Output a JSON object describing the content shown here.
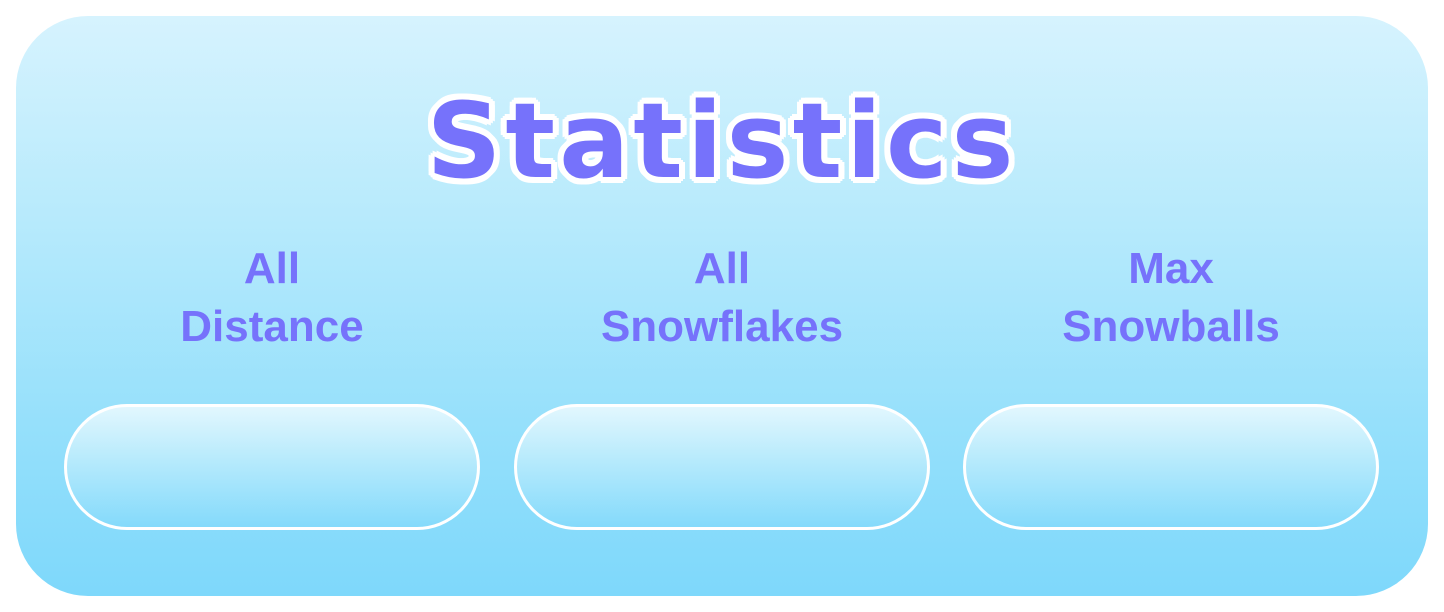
{
  "title": "Statistics",
  "stats": [
    {
      "label_line1": "All",
      "label_line2": "Distance",
      "value": ""
    },
    {
      "label_line1": "All",
      "label_line2": "Snowflakes",
      "value": ""
    },
    {
      "label_line1": "Max",
      "label_line2": "Snowballs",
      "value": ""
    }
  ],
  "colors": {
    "accent": "#7672fb",
    "panel_top": "#d6f3fe",
    "panel_bottom": "#7ed8fb",
    "outline": "#ffffff"
  }
}
